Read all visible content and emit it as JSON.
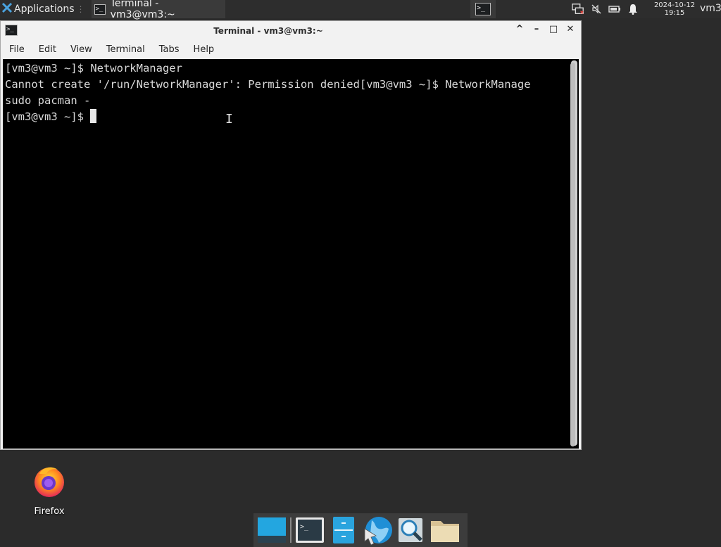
{
  "top_panel": {
    "applications_label": "Applications",
    "task_title": "Terminal - vm3@vm3:~",
    "clock_date": "2024-10-12",
    "clock_time": "19:15",
    "username": "vm3"
  },
  "window": {
    "title": "Terminal - vm3@vm3:~",
    "controls": {
      "shade": "^",
      "minimize": "–",
      "maximize": "□",
      "close": "✕"
    },
    "menu": [
      "File",
      "Edit",
      "View",
      "Terminal",
      "Tabs",
      "Help"
    ]
  },
  "terminal": {
    "lines": [
      "[vm3@vm3 ~]$ NetworkManager",
      "Cannot create '/run/NetworkManager': Permission denied[vm3@vm3 ~]$ NetworkManage",
      "sudo pacman -",
      "[vm3@vm3 ~]$ "
    ]
  },
  "desktop": {
    "firefox_label": "Firefox"
  },
  "dock": {
    "items": [
      "show-desktop",
      "terminal",
      "file-manager",
      "web-browser",
      "app-finder",
      "home-folder"
    ]
  },
  "colors": {
    "panel_bg": "#2d2d2d",
    "desktop_bg": "#2b2b2b",
    "terminal_bg": "#000000",
    "terminal_fg": "#d9d9d9",
    "window_chrome": "#f2f2f2"
  }
}
